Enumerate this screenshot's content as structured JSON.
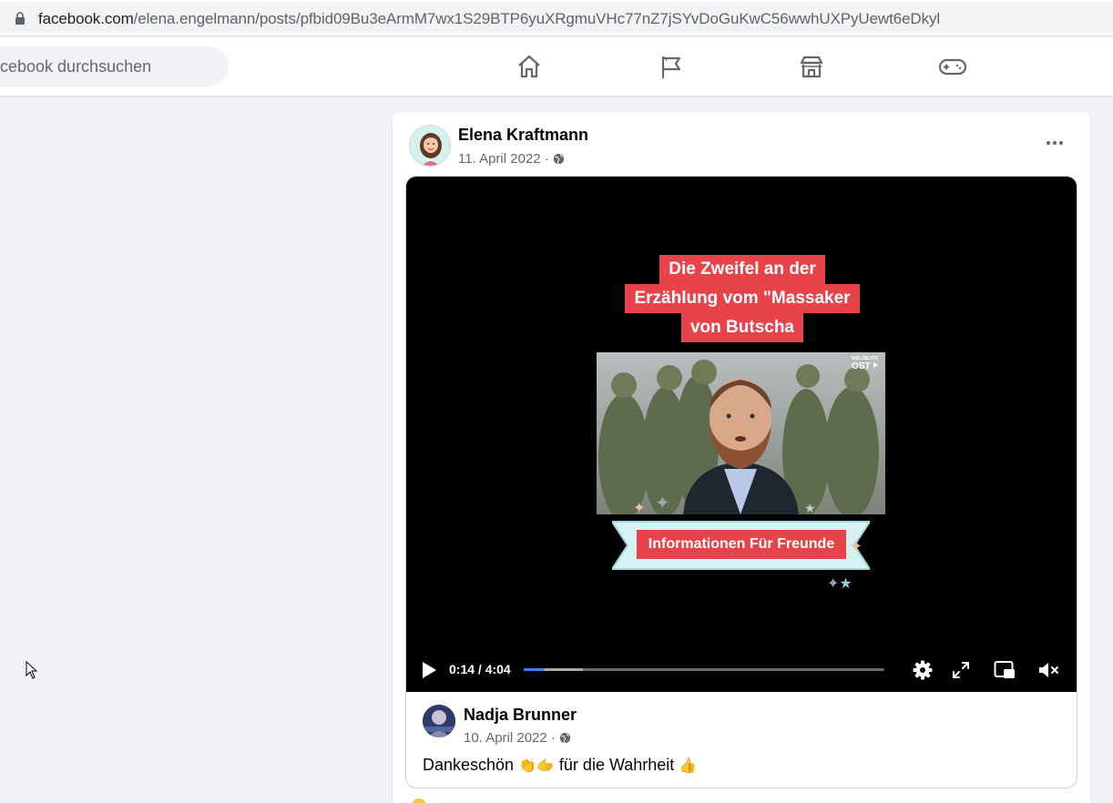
{
  "browser": {
    "url_host": "facebook.com",
    "url_path": "/elena.engelmann/posts/pfbid09Bu3eArmM7wx1S29BTP6yuXRgmuVHc77nZ7jSYvDoGuKwC56wwhUXPyUewt6eDkyl"
  },
  "nav": {
    "search_placeholder": "cebook durchsuchen",
    "icons": [
      "home-icon",
      "pages-flag-icon",
      "marketplace-icon",
      "gaming-icon"
    ]
  },
  "post": {
    "author": "Elena Kraftmann",
    "date": "11. April 2022 ·",
    "video": {
      "headline_lines": [
        "Die Zweifel an der",
        "Erzählung vom \"Massaker",
        "von Butscha"
      ],
      "thumbnail_badge_small": "WELTBLICK",
      "thumbnail_badge": "OST",
      "banner": "Informationen Für Freunde",
      "time": "0:14 / 4:04",
      "progress_fraction": 0.058
    },
    "shared_comment": {
      "author": "Nadja Brunner",
      "date": "10. April 2022 ·",
      "text_before": "Dankeschön ",
      "emoji_1": "👏🫱",
      "text_middle": " für die Wahrheit ",
      "emoji_2": "👍"
    }
  },
  "colors": {
    "accent_red": "#e8434a",
    "progress_blue": "#2d88ff"
  }
}
